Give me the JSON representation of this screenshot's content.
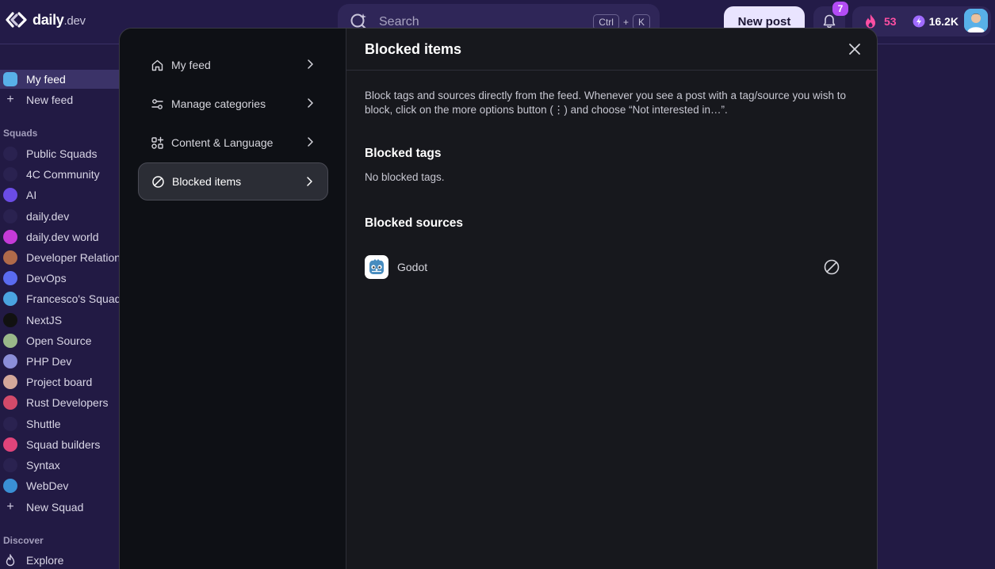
{
  "header": {
    "logo_text": "daily",
    "logo_suffix": ".dev",
    "search_placeholder": "Search",
    "shortcut_ctrl": "Ctrl",
    "shortcut_plus": "+",
    "shortcut_key": "K",
    "new_post_label": "New post",
    "notification_count": "7",
    "streak": "53",
    "reputation": "16.2K"
  },
  "sidebar": {
    "my_feed": "My feed",
    "new_feed": "New feed",
    "squads_heading": "Squads",
    "squads": [
      {
        "label": "Public Squads",
        "color": "#2a2250"
      },
      {
        "label": "4C Community",
        "color": "#2a2250"
      },
      {
        "label": "AI",
        "color": "#6b4ce6"
      },
      {
        "label": "daily.dev",
        "color": "#2a2250"
      },
      {
        "label": "daily.dev world",
        "color": "#c53ad8"
      },
      {
        "label": "Developer Relations",
        "color": "#b06a4a"
      },
      {
        "label": "DevOps",
        "color": "#5a6bf0"
      },
      {
        "label": "Francesco's Squad",
        "color": "#4aa3e0"
      },
      {
        "label": "NextJS",
        "color": "#111111"
      },
      {
        "label": "Open Source",
        "color": "#9ab88a"
      },
      {
        "label": "PHP Dev",
        "color": "#8b8ed8"
      },
      {
        "label": "Project board",
        "color": "#d4a89a"
      },
      {
        "label": "Rust Developers",
        "color": "#d34a6a"
      },
      {
        "label": "Shuttle",
        "color": "#2a2250"
      },
      {
        "label": "Squad builders",
        "color": "#e0447a"
      },
      {
        "label": "Syntax",
        "color": "#2a2250"
      },
      {
        "label": "WebDev",
        "color": "#3a8fd4"
      }
    ],
    "new_squad": "New Squad",
    "discover_heading": "Discover",
    "explore": "Explore"
  },
  "modal": {
    "nav": [
      {
        "label": "My feed"
      },
      {
        "label": "Manage categories"
      },
      {
        "label": "Content & Language"
      },
      {
        "label": "Blocked items"
      }
    ],
    "title": "Blocked items",
    "description": "Block tags and sources directly from the feed. Whenever you see a post with a tag/source you wish to block, click on the more options button (⋮) and choose “Not interested in…”.",
    "blocked_tags_title": "Blocked tags",
    "blocked_tags_empty": "No blocked tags.",
    "blocked_sources_title": "Blocked sources",
    "sources": [
      {
        "name": "Godot"
      }
    ]
  },
  "colors": {
    "accent_streak": "#ff4fa3",
    "notification_badge": "#b34cf5",
    "new_post_bg": "#e9e4ff",
    "modal_bg": "#17181d"
  }
}
